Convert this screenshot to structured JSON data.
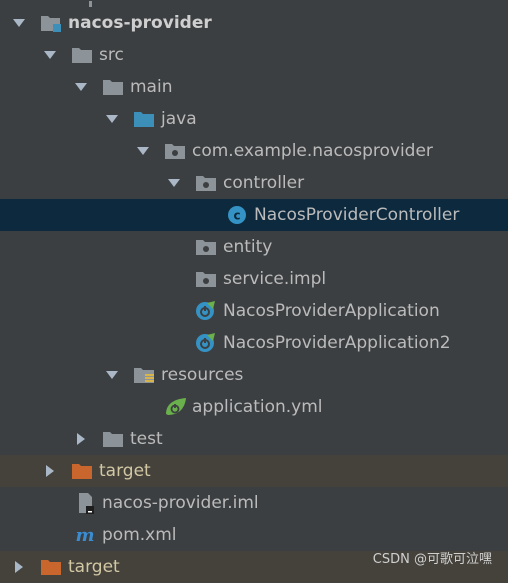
{
  "tree": {
    "items": [
      {
        "label": "nacos-provider",
        "expanded": true,
        "icon": "module-folder-icon"
      },
      {
        "label": "src",
        "expanded": true,
        "icon": "folder-icon"
      },
      {
        "label": "main",
        "expanded": true,
        "icon": "folder-icon"
      },
      {
        "label": "java",
        "expanded": true,
        "icon": "source-root-folder-icon"
      },
      {
        "label": "com.example.nacosprovider",
        "expanded": true,
        "icon": "package-icon"
      },
      {
        "label": "controller",
        "expanded": true,
        "icon": "package-icon"
      },
      {
        "label": "NacosProviderController",
        "selected": true,
        "icon": "java-class-icon"
      },
      {
        "label": "entity",
        "icon": "package-icon"
      },
      {
        "label": "service.impl",
        "icon": "package-icon"
      },
      {
        "label": "NacosProviderApplication",
        "icon": "spring-boot-class-icon"
      },
      {
        "label": "NacosProviderApplication2",
        "icon": "spring-boot-class-icon"
      },
      {
        "label": "resources",
        "expanded": true,
        "icon": "resources-folder-icon"
      },
      {
        "label": "application.yml",
        "icon": "spring-yml-icon"
      },
      {
        "label": "test",
        "expanded": false,
        "icon": "folder-icon"
      },
      {
        "label": "target",
        "expanded": false,
        "icon": "excluded-folder-icon"
      },
      {
        "label": "nacos-provider.iml",
        "icon": "iml-file-icon"
      },
      {
        "label": "pom.xml",
        "icon": "maven-icon"
      },
      {
        "label": "target",
        "expanded": false,
        "icon": "excluded-folder-icon"
      }
    ]
  },
  "colors": {
    "background": "#3c3f41",
    "selected_row": "#0d293e",
    "excluded_row": "#45423c",
    "folder_gray": "#8c9499",
    "source_blue": "#3c8fb8",
    "excluded_orange": "#c9662e",
    "class_blue": "#3592c4",
    "spring_green": "#6ab04c"
  },
  "watermark": "CSDN @可歌可泣嘿"
}
